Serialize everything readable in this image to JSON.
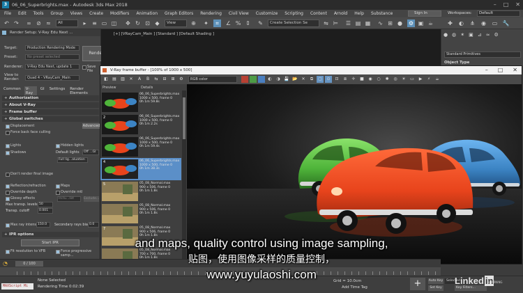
{
  "window": {
    "title": "06_06_Superbrights.max - Autodesk 3ds Max 2018"
  },
  "menu": {
    "items": [
      "File",
      "Edit",
      "Tools",
      "Group",
      "Views",
      "Create",
      "Modifiers",
      "Animation",
      "Graph Editors",
      "Rendering",
      "Civil View",
      "Customize",
      "Scripting",
      "Content",
      "Arnold",
      "Help",
      "Substance"
    ],
    "sign_in": "Sign In",
    "workspaces_label": "Workspaces:",
    "workspaces_value": "Default"
  },
  "toolbar": {
    "filter_value": "All",
    "view_value": "View",
    "selection_set_placeholder": "Create Selection Se"
  },
  "render_setup": {
    "title": "Render Setup: V-Ray Edu Next ...",
    "target_label": "Target:",
    "target_value": "Production Rendering Mode",
    "preset_label": "Preset:",
    "preset_value": "No preset selected",
    "renderer_label": "Renderer:",
    "renderer_value": "V-Ray Edu Next, update 1",
    "save_file_label": "Save File",
    "view_label": "View to Render:",
    "view_value": "Quad 4 - VRayCam_Main",
    "render_button": "Render",
    "tabs": [
      "Common",
      "V-Ray",
      "GI",
      "Settings",
      "Render Elements"
    ],
    "rollouts": {
      "authorization": "Authorization",
      "about": "About V-Ray",
      "frame_buffer": "Frame buffer",
      "global_switches": "Global switches",
      "ipr_options": "IPR options"
    },
    "options": {
      "displacement": "Displacement",
      "force_back_face_culling": "Force back face culling",
      "advanced": "Advanced",
      "lights": "Lights",
      "hidden_lights": "Hidden lights",
      "shadows": "Shadows",
      "default_lights": "Default lights",
      "default_lights_value": "Off ...GI",
      "full_lighting_eval": "Full lig...aluation",
      "dont_render_final": "Don't render final image",
      "reflection_refraction": "Reflection/refraction",
      "maps": "Maps",
      "override_depth": "Override depth",
      "override_mtl": "Override mtl",
      "override_mtl_value": "Inclu...list",
      "exclude": "Exclude...",
      "glossy_effects": "Glossy effects",
      "max_transp_levels": "Max transp. levels",
      "max_transp_value": "50",
      "transp_cutoff": "Transp. cutoff",
      "transp_cutoff_value": "0.001",
      "max_ray_intens": "Max ray intens.",
      "max_ray_intens_value": "150.0",
      "secondary_rays_bias": "Secondary rays bias",
      "secondary_rays_bias_value": "0.0",
      "start_ipr": "Start IPR",
      "fit_resolution": "Fit resolution to VFB",
      "force_progressive": "Force progressive samp..."
    }
  },
  "viewport": {
    "label": "[+] [VRayCam_Main ] [Standard ] [Default Shading ]"
  },
  "command_panel": {
    "dropdown": "Standard Primitives",
    "object_type": "Object Type"
  },
  "vfb": {
    "title": "V-Ray frame buffer - [100% of 1000 x 500]",
    "channel": "RGB color",
    "history_headers": [
      "Preview",
      "Details"
    ],
    "history": [
      {
        "num": "",
        "name": "06_06_Superbrights.max",
        "res": "1000 x 500, frame 0",
        "time": "0h 1m 59.8s",
        "thumb": "orange-green",
        "selected": false
      },
      {
        "num": "2",
        "name": "06_06_Superbrights.max",
        "res": "1000 x 500, frame 0",
        "time": "0h 1m 2.2s",
        "thumb": "orange-green",
        "selected": false
      },
      {
        "num": "",
        "name": "06_06_Superbrights.max",
        "res": "1000 x 500, frame 0",
        "time": "0h 1m 59.4s",
        "thumb": "orange-green",
        "selected": false
      },
      {
        "num": "4",
        "name": "06_06_Superbrights.max",
        "res": "1000 x 500, frame 0",
        "time": "0h 1m 38.3s",
        "thumb": "orange-blue",
        "selected": true
      },
      {
        "num": "5",
        "name": "05_08_Normal.max",
        "res": "900 x 506, frame 0",
        "time": "0h 1m 1.8s",
        "thumb": "sand",
        "selected": false
      },
      {
        "num": "",
        "name": "05_08_Normal.max",
        "res": "900 x 506, frame 0",
        "time": "0h 1m 1.8s",
        "thumb": "sand",
        "selected": false
      },
      {
        "num": "7",
        "name": "05_08_Normal.max",
        "res": "900 x 506, frame 0",
        "time": "0h 1m 1.8s",
        "thumb": "sand",
        "selected": false
      },
      {
        "num": "",
        "name": "05_08_Normal.max",
        "res": "700 x 700, frame 0",
        "time": "0h 1m 1.8s",
        "thumb": "sand",
        "selected": false
      }
    ]
  },
  "timeline": {
    "frame": "0 / 100"
  },
  "status": {
    "script_text": "MAXScript Mi",
    "selection": "None Selected",
    "render_time": "Rendering Time 0:02:39",
    "grid": "Grid = 10.0cm",
    "add_time_tag": "Add Time Tag",
    "auto_key": "Auto Key",
    "selected": "Selected",
    "set_key": "Set Key",
    "key_filters": "Key Filters..."
  },
  "watermark": {
    "brand_a": "Linked",
    "brand_b": "in",
    "sub": "LEARNING"
  },
  "subtitles": {
    "english": "and maps, quality control using image sampling,",
    "chinese": "贴图，使用图像采样的质量控制，",
    "url": "www.yuyulaoshi.com"
  },
  "colors": {
    "accent": "#5b8fc8",
    "car_red": "#e8441c",
    "car_green": "#4fb43a",
    "car_blue": "#3c84c4"
  }
}
